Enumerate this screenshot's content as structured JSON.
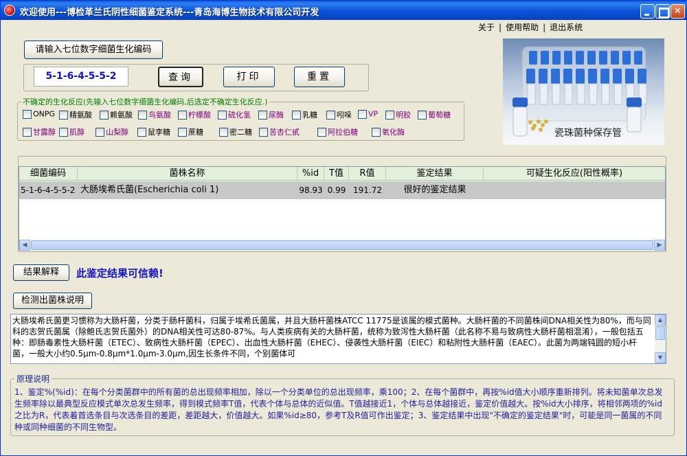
{
  "window": {
    "title": "欢迎使用---博检革兰氏阴性细菌鉴定系统---青岛海博生物技术有限公司开发",
    "controls": [
      "minimize-icon",
      "maximize-icon",
      "close-icon"
    ]
  },
  "topmenu": {
    "about": "关于",
    "sep": "|",
    "help": "使用帮助",
    "exit": "退出系统"
  },
  "input": {
    "prompt": "请输入七位数字细菌生化编码",
    "code": "5-1-6-4-5-5-2"
  },
  "buttons": {
    "query": "查询",
    "print": "打印",
    "reset": "重置",
    "explain": "结果解释",
    "strain": "检测出菌株说明"
  },
  "uncertain": {
    "legend": "不确定的生化反应(先输入七位数字细菌生化编码,后选定不确定生化反应.)",
    "row1": [
      "ONPG",
      "精氨酸",
      "赖氨酸",
      "鸟氨酸",
      "柠檬酸",
      "硫化氢",
      "尿酶",
      "乳糖",
      "吲哚",
      "VP",
      "明胶",
      "葡萄糖"
    ],
    "row2": [
      "甘露醇",
      "肌醇",
      "山梨醇",
      "鼠李糖",
      "蔗糖",
      "密二糖",
      "苦杏仁甙",
      "阿拉伯糖",
      "氧化酶"
    ]
  },
  "image": {
    "caption": "瓷珠菌种保存管"
  },
  "results": {
    "columns": [
      "细菌编码",
      "菌株名称",
      "%id",
      "T值",
      "R值",
      "鉴定结果",
      "可疑生化反应(阳性概率)"
    ],
    "rows": [
      [
        "5-1-6-4-5-5-2",
        "大肠埃希氏菌(Escherichia coli 1)",
        "98.93",
        "0.99",
        "191.72",
        "很好的鉴定结果",
        ""
      ]
    ]
  },
  "verdict": "此鉴定结果可信赖!",
  "description": "大肠埃希氏菌更习惯称为大肠杆菌，分类于肠杆菌科，归属于埃希氏菌属，并且大肠杆菌株ATCC 11775是该属的模式菌种。大肠杆菌的不同菌株间DNA相关性为80%，而与同科的志贺氏菌属（除鲍氏志贺氏菌外）的DNA相关性可达80-87%。与人类疾病有关的大肠杆菌，统称为致泻性大肠杆菌（此名称不易与致病性大肠杆菌相混淆），一般包括五种：即肠毒素性大肠杆菌（ETEC）、致病性大肠杆菌（EPEC）、出血性大肠杆菌（EHEC）、侵袭性大肠杆菌（EIEC）和粘附性大肠杆菌（EAEC）。此菌为两端钝圆的短小杆菌，一般大小约0.5μm-0.8μm*1.0μm-3.0μm,因生长条件不同，个别菌体可",
  "principle": {
    "legend": "原理说明",
    "text": "1、鉴定%(%id)：在每个分类菌群中的所有菌的总出现频率相加，除以一个分类单位的总出现频率，乘100；2、在每个菌群中，再按%id值大小顺序重新排列。将未知菌单次总发生频率除以最典型反应模式单次总发生频率，得到模式频率T值，代表个体与总体的近似值。T值越接近1，个体与总体越接近，鉴定价值越大。按%id大小排序，将相邻两项的%id之比为R，代表着首选条目与次选条目的差距，差距越大，价值越大。如果%id≥80，参考T及R值可作出鉴定；3、鉴定结果中出现\"不确定的鉴定结果\"时，可能是同一菌属的不同种或同种细菌的不同生物型。"
  },
  "colors": {
    "title_bar": "#0a52d6",
    "window_bg": "#ece9d8",
    "legend_green": "#008000",
    "verdict_blue": "#1515c0",
    "row_selected": "#c8c8c8",
    "header_green": "#e3f0da"
  }
}
